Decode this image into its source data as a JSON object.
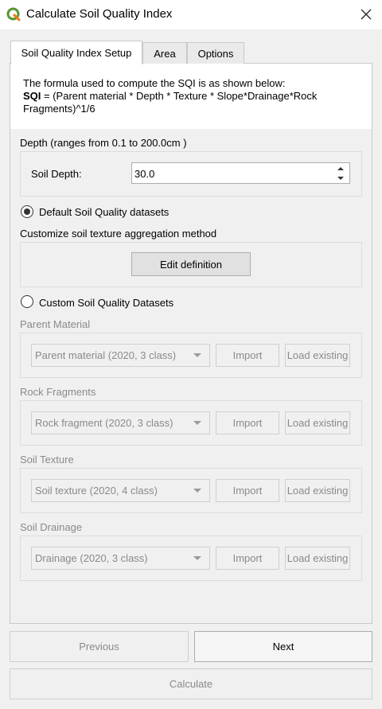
{
  "window": {
    "title": "Calculate Soil Quality Index"
  },
  "tabs": [
    {
      "label": "Soil Quality Index Setup"
    },
    {
      "label": "Area"
    },
    {
      "label": "Options"
    }
  ],
  "formula": {
    "intro": "The formula used to compute the SQI is as shown below:",
    "name": "SQI",
    "expression_line1": " = (Parent material * Depth * Texture * Slope*Drainage*Rock",
    "expression_line2": "Fragments)^1/6"
  },
  "depth": {
    "section_label": "Depth (ranges from 0.1 to 200.0cm )",
    "field_label": "Soil Depth:",
    "value": "30.0"
  },
  "default_datasets": {
    "label": "Default Soil Quality datasets",
    "selected": true,
    "customize_label": "Customize soil texture aggregation method",
    "edit_button": "Edit definition"
  },
  "custom_datasets": {
    "label": "Custom Soil Quality Datasets",
    "selected": false,
    "import_label": "Import",
    "load_label": "Load existing",
    "groups": [
      {
        "title": "Parent Material",
        "selected": "Parent material (2020, 3 class)"
      },
      {
        "title": "Rock Fragments",
        "selected": "Rock fragment (2020, 3 class)"
      },
      {
        "title": "Soil Texture",
        "selected": "Soil texture (2020, 4 class)"
      },
      {
        "title": "Soil Drainage",
        "selected": "Drainage (2020, 3 class)"
      }
    ]
  },
  "footer": {
    "previous": "Previous",
    "next": "Next",
    "calculate": "Calculate"
  },
  "colors": {
    "qgis_green": "#589632",
    "qgis_yellow": "#ee7913"
  }
}
